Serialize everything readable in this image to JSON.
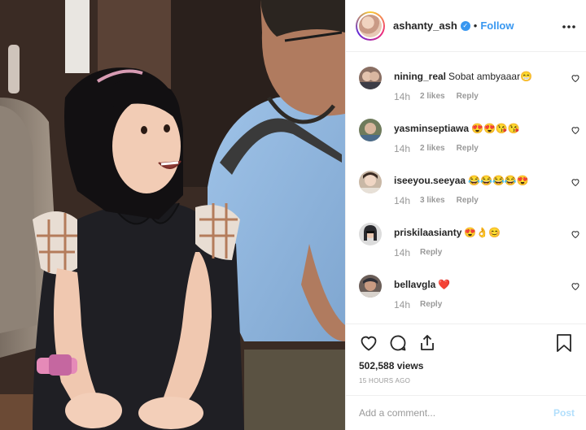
{
  "post": {
    "username": "ashanty_ash",
    "separator": "•",
    "follow_label": "Follow",
    "more_label": "•••",
    "verified_mark": "✓"
  },
  "comments": [
    {
      "user": "nining_real",
      "text": "Sobat ambyaaar😁",
      "time": "14h",
      "likes": "2 likes",
      "reply": "Reply",
      "avatar_color": "#8a6f63"
    },
    {
      "user": "yasminseptiawa",
      "text": "😍😍😘😘",
      "time": "14h",
      "likes": "2 likes",
      "reply": "Reply",
      "avatar_color": "#6f7b5c"
    },
    {
      "user": "iseeyou.seeyaa",
      "text": "😂😂😂😂😍",
      "time": "14h",
      "likes": "3 likes",
      "reply": "Reply",
      "avatar_color": "#c9b8a6"
    },
    {
      "user": "priskilaasianty",
      "text": "😍👌😊",
      "time": "14h",
      "likes": "",
      "reply": "Reply",
      "avatar_color": "#3d4a52"
    },
    {
      "user": "bellavgla",
      "text": "❤️",
      "time": "14h",
      "likes": "",
      "reply": "Reply",
      "avatar_color": "#6b5e58"
    }
  ],
  "stats": {
    "views": "502,588 views",
    "time_ago": "15 HOURS AGO"
  },
  "composer": {
    "placeholder": "Add a comment...",
    "post_label": "Post"
  },
  "colors": {
    "accent": "#3897f0",
    "post_disabled": "#b2dffc",
    "muted": "#999999"
  }
}
